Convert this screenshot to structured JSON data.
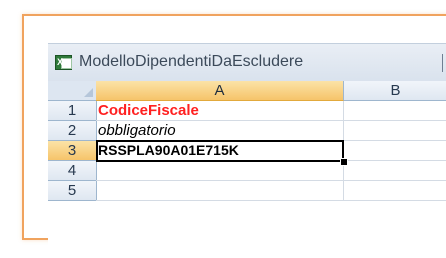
{
  "window": {
    "title": "ModelloDipendentiDaEscludere",
    "app_icon": "excel-icon",
    "app_icon_glyph": "X"
  },
  "columns": [
    "A",
    "B"
  ],
  "rows": [
    {
      "num": "1",
      "a": "CodiceFiscale",
      "b": ""
    },
    {
      "num": "2",
      "a": "obbligatorio",
      "b": ""
    },
    {
      "num": "3",
      "a": "RSSPLA90A01E715K",
      "b": ""
    },
    {
      "num": "4",
      "a": "",
      "b": ""
    },
    {
      "num": "5",
      "a": "",
      "b": ""
    }
  ],
  "selection": {
    "active_column": "A",
    "active_row": "3"
  },
  "colors": {
    "frame_accent": "#f0a35e",
    "header_red": "#ff2020",
    "active_header": "#f6c46a"
  }
}
